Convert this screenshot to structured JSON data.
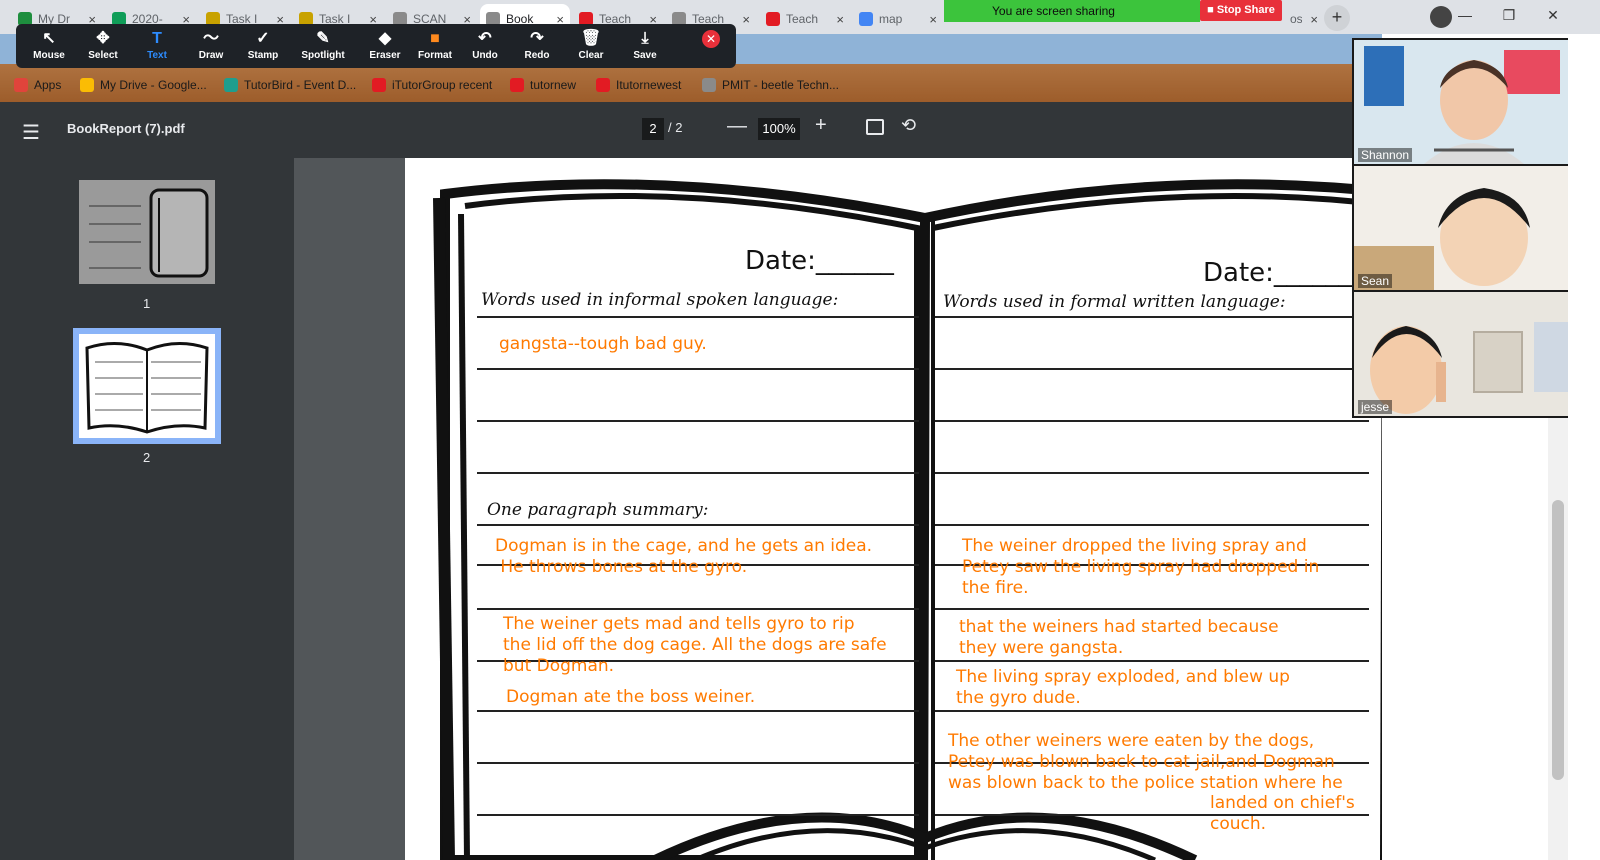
{
  "tabs": [
    {
      "title": "My Dr",
      "color": "#1e8e3e",
      "active": false
    },
    {
      "title": "2020-",
      "color": "#0f9d58",
      "active": false
    },
    {
      "title": "Task I",
      "color": "#c8a200",
      "active": false
    },
    {
      "title": "Task I",
      "color": "#c8a200",
      "active": false
    },
    {
      "title": "SCAN",
      "color": "#8a8a8a",
      "active": false
    },
    {
      "title": "Book",
      "color": "#8a8a8a",
      "active": true
    },
    {
      "title": "Teach",
      "color": "#e21b23",
      "active": false
    },
    {
      "title": "Teach",
      "color": "#8a8a8a",
      "active": false
    },
    {
      "title": "Teach",
      "color": "#e21b23",
      "active": false
    },
    {
      "title": "map",
      "color": "#4285f4",
      "active": false
    }
  ],
  "tab_close_glyph": "×",
  "new_tab_glyph": "+",
  "window_controls": {
    "minimize": "—",
    "restore": "❐",
    "close": "✕"
  },
  "share_banner": {
    "text": "You are screen sharing",
    "stop_label": "Stop Share",
    "partial_tab_title": "ost /"
  },
  "annotation_toolbar": {
    "tools": [
      {
        "name": "mouse",
        "label": "Mouse",
        "icon": "↖",
        "active": false
      },
      {
        "name": "select",
        "label": "Select",
        "icon": "✥",
        "active": false
      },
      {
        "name": "text",
        "label": "Text",
        "icon": "T",
        "active": true
      },
      {
        "name": "draw",
        "label": "Draw",
        "icon": "〜",
        "active": false
      },
      {
        "name": "stamp",
        "label": "Stamp",
        "icon": "✓",
        "active": false
      },
      {
        "name": "spotlight",
        "label": "Spotlight",
        "icon": "✎",
        "active": false
      },
      {
        "name": "eraser",
        "label": "Eraser",
        "icon": "◆",
        "active": false
      },
      {
        "name": "format",
        "label": "Format",
        "icon": "■",
        "active": false
      },
      {
        "name": "undo",
        "label": "Undo",
        "icon": "↶",
        "active": false
      },
      {
        "name": "redo",
        "label": "Redo",
        "icon": "↷",
        "active": false
      },
      {
        "name": "clear",
        "label": "Clear",
        "icon": "🗑",
        "active": false
      },
      {
        "name": "save",
        "label": "Save",
        "icon": "⤓",
        "active": false
      }
    ],
    "close_glyph": "✕",
    "format_color": "#ff8a1e"
  },
  "bookmarks": [
    {
      "label": "Apps",
      "color": "#e0443b"
    },
    {
      "label": "My Drive - Google...",
      "color": "#fbbc04"
    },
    {
      "label": "TutorBird - Event D...",
      "color": "#1e9e8e"
    },
    {
      "label": "iTutorGroup recent",
      "color": "#e21b23"
    },
    {
      "label": "tutornew",
      "color": "#e21b23"
    },
    {
      "label": "Itutornewest",
      "color": "#e21b23"
    },
    {
      "label": "PMIT - beetle Techn...",
      "color": "#8a8a8a"
    }
  ],
  "pdf_viewer": {
    "menu_icon": "☰",
    "filename": "BookReport (7).pdf",
    "current_page": "2",
    "page_total_text": "/  2",
    "zoom": "100%",
    "zoom_out": "—",
    "zoom_in": "+",
    "rotate_icon": "⟲"
  },
  "thumbnails": [
    {
      "number": "1"
    },
    {
      "number": "2"
    }
  ],
  "document": {
    "left_date": "Date:______",
    "right_date": "Date:______",
    "left_heading": "Words used in informal spoken language:",
    "right_heading": "Words used in formal written language:",
    "summary_heading": "One paragraph summary:",
    "answers": {
      "informal_1": "gangsta--tough bad guy.",
      "left_1": "Dogman is in the cage, and he gets an idea.\n He throws bones at the gyro.",
      "left_2": "The weiner gets mad and tells gyro to rip\nthe lid off the dog cage. All the dogs are safe\nbut Dogman.",
      "left_3": "Dogman ate the boss weiner.",
      "right_1": "The weiner dropped the living spray and\nPetey saw the living spray had dropped in\nthe fire.",
      "right_2": "that the weiners had started because\nthey were gangsta.",
      "right_3": "The living spray exploded, and blew up\nthe gyro dude.",
      "right_4": "The other weiners were eaten by the dogs,\nPetey was blown back to cat jail,and Dogman\nwas blown back to the police station where he",
      "right_4b": "landed on chief's\ncouch."
    }
  },
  "participants": [
    {
      "name": "Shannon"
    },
    {
      "name": "Sean"
    },
    {
      "name": "jesse"
    }
  ]
}
